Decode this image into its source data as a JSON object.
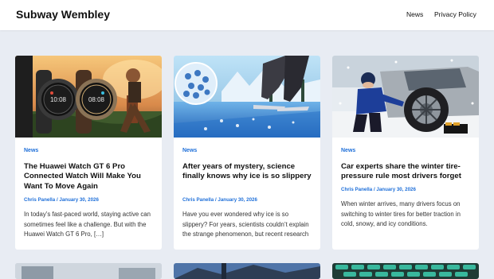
{
  "site": {
    "title": "Subway Wembley"
  },
  "nav": [
    {
      "label": "News"
    },
    {
      "label": "Privacy Policy"
    }
  ],
  "posts": [
    {
      "category": "News",
      "title": "The Huawei Watch GT 6 Pro Connected Watch Will Make You Want To Move Again",
      "author": "Chris Panella",
      "date": "January 30, 2026",
      "excerpt": "In today’s fast-paced world, staying active can sometimes feel like a challenge. But with the Huawei Watch GT 6 Pro, […]",
      "image_icon": "smartwatch-runner-image"
    },
    {
      "category": "News",
      "title": "After years of mystery, science finally knows why ice is so slippery",
      "author": "Chris Panella",
      "date": "January 30, 2026",
      "excerpt": "Have you ever wondered why ice is so slippery? For years, scientists couldn’t explain the strange phenomenon, but recent research",
      "image_icon": "ice-skater-image"
    },
    {
      "category": "News",
      "title": "Car experts share the winter tire-pressure rule most drivers forget",
      "author": "Chris Panella",
      "date": "January 30, 2026",
      "excerpt": "When winter arrives, many drivers focus on switching to winter tires for better traction in cold, snowy, and icy conditions.",
      "image_icon": "winter-tire-image"
    }
  ],
  "meta_separator": "/"
}
